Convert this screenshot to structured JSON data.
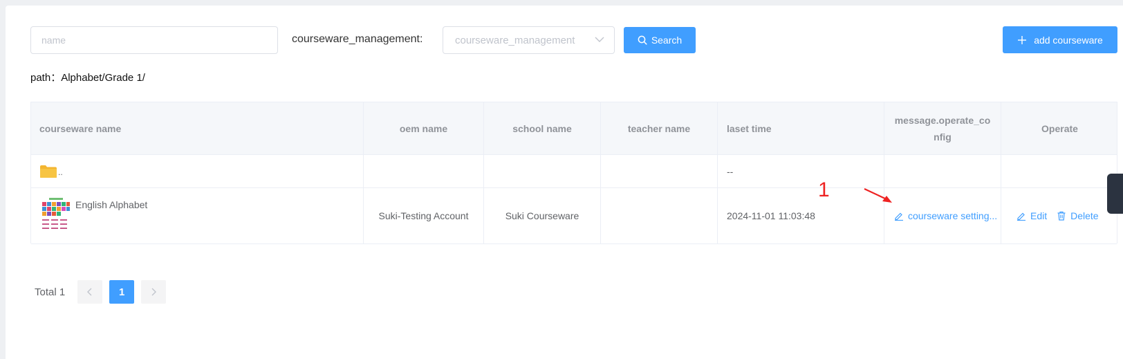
{
  "filters": {
    "name_placeholder": "name",
    "courseware_label": "courseware_management:",
    "courseware_select_placeholder": "courseware_management",
    "search_label": "Search",
    "add_label": "add courseware"
  },
  "path": {
    "label": "path：",
    "value": "Alphabet/Grade 1/"
  },
  "table": {
    "columns": [
      "courseware name",
      "oem name",
      "school name",
      "teacher name",
      "laset time",
      "message.operate_config",
      "Operate"
    ],
    "rows": [
      {
        "name": "..",
        "oem": "",
        "school": "",
        "teacher": "",
        "time": "--"
      },
      {
        "name": "English Alphabet",
        "oem": "Suki-Testing Account",
        "school": "Suki Courseware",
        "teacher": "",
        "time": "2024-11-01 11:03:48",
        "config_link": "courseware setting...",
        "edit": "Edit",
        "delete": "Delete"
      }
    ]
  },
  "annotation": {
    "number": "1",
    "color": "#ee2222"
  },
  "pagination": {
    "total": "Total 1",
    "current": "1"
  },
  "colors": {
    "primary": "#409eff",
    "header_bg": "#f5f7fa",
    "border": "#ebeef5"
  }
}
